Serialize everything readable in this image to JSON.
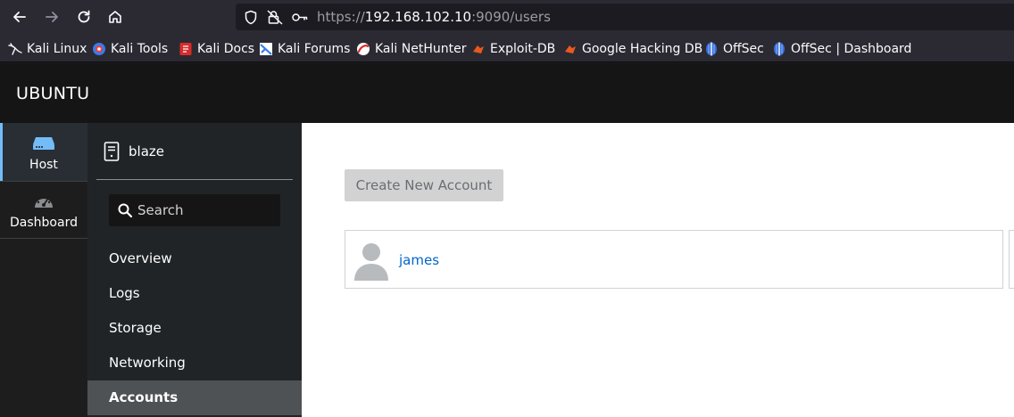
{
  "browser": {
    "url_scheme": "https://",
    "url_host": "192.168.102.10",
    "url_rest": ":9090/users",
    "bookmarks": [
      {
        "label": "Kali Linux",
        "icon": "kali-dragon-icon"
      },
      {
        "label": "Kali Tools",
        "icon": "kali-tools-icon"
      },
      {
        "label": "Kali Docs",
        "icon": "kali-docs-icon"
      },
      {
        "label": "Kali Forums",
        "icon": "kali-forums-icon"
      },
      {
        "label": "Kali NetHunter",
        "icon": "kali-nethunter-icon"
      },
      {
        "label": "Exploit-DB",
        "icon": "exploit-db-icon"
      },
      {
        "label": "Google Hacking DB",
        "icon": "ghdb-icon"
      },
      {
        "label": "OffSec",
        "icon": "offsec-icon"
      },
      {
        "label": "OffSec | Dashboard",
        "icon": "offsec-icon"
      }
    ]
  },
  "cockpit": {
    "brand": "UBUNTU",
    "rail": {
      "host_label": "Host",
      "dashboard_label": "Dashboard"
    },
    "host_name": "blaze",
    "search_placeholder": "Search",
    "menu": [
      "Overview",
      "Logs",
      "Storage",
      "Networking",
      "Accounts"
    ],
    "active_menu": "Accounts",
    "create_button": "Create New Account",
    "accounts": [
      {
        "name": "james"
      }
    ]
  },
  "colors": {
    "accent": "#73bcf7",
    "link": "#0066cc",
    "topbar": "#151515"
  }
}
